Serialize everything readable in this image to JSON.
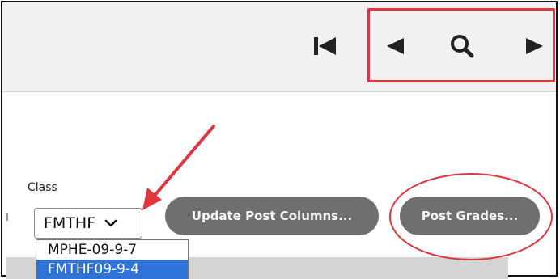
{
  "toolbar": {
    "buttons": [
      {
        "name": "first-page",
        "icon": "skip-to-start-icon"
      },
      {
        "name": "previous",
        "icon": "triangle-left-icon"
      },
      {
        "name": "search",
        "icon": "magnifier-icon"
      },
      {
        "name": "next",
        "icon": "triangle-right-icon"
      }
    ]
  },
  "form": {
    "class_label": "Class",
    "class_selected": "FMTHF",
    "class_options": [
      "MPHE-09-9-7",
      "FMTHF09-9-4"
    ],
    "highlighted_option_index": 1
  },
  "actions": {
    "update_post_columns_label": "Update Post Columns...",
    "post_grades_label": "Post Grades..."
  },
  "annotations": {
    "highlight_color": "#e0373f",
    "arrow_color": "#e0373f"
  },
  "colors": {
    "pill_bg": "#6f6f6f",
    "topbar_bg": "#f1f1f1",
    "selected_option_bg": "#2f73d8"
  }
}
